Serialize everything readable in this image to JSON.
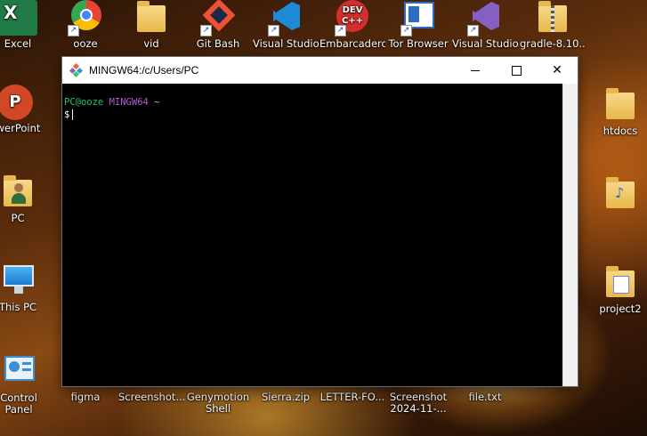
{
  "desktop": {
    "icons": [
      {
        "label": "Excel",
        "icon": "excel-icon"
      },
      {
        "label": "ooze",
        "icon": "chrome-icon"
      },
      {
        "label": "vid",
        "icon": "folder-icon"
      },
      {
        "label": "Git Bash",
        "icon": "git-bash-icon"
      },
      {
        "label": "Visual Studio",
        "icon": "vscode-icon"
      },
      {
        "label": "Embarcadero",
        "icon": "dev-cpp-icon"
      },
      {
        "label": "Tor Browser",
        "icon": "tor-browser-icon"
      },
      {
        "label": "Visual Studio",
        "icon": "visual-studio-icon"
      },
      {
        "label": "gradle-8.10...",
        "icon": "zip-folder-icon"
      },
      {
        "label": "owerPoint",
        "icon": "powerpoint-icon"
      },
      {
        "label": "htdocs",
        "icon": "folder-icon"
      },
      {
        "label": "PC",
        "icon": "user-folder-icon"
      },
      {
        "label": "This PC",
        "icon": "computer-icon"
      },
      {
        "label": "project2",
        "icon": "folder-icon"
      },
      {
        "label": "Control Panel",
        "icon": "control-panel-icon"
      },
      {
        "label": "figma",
        "icon": "figma-icon"
      },
      {
        "label": "Screenshot...",
        "icon": "image-icon"
      },
      {
        "label": "Genymotion Shell",
        "icon": "genymotion-icon"
      },
      {
        "label": "Sierra.zip",
        "icon": "zip-icon"
      },
      {
        "label": "LETTER-FO...",
        "icon": "document-icon"
      },
      {
        "label": "Screenshot 2024-11-...",
        "icon": "image-icon"
      },
      {
        "label": "file.txt",
        "icon": "text-file-icon"
      }
    ]
  },
  "window": {
    "title": "MINGW64:/c/Users/PC",
    "prompt_user": "PC@ooze",
    "prompt_env": "MINGW64",
    "prompt_path": "~",
    "prompt_symbol": "$"
  },
  "colors": {
    "prompt_user": "#22c55e",
    "prompt_env": "#b45ad6",
    "prompt_path": "#d7c34a"
  }
}
